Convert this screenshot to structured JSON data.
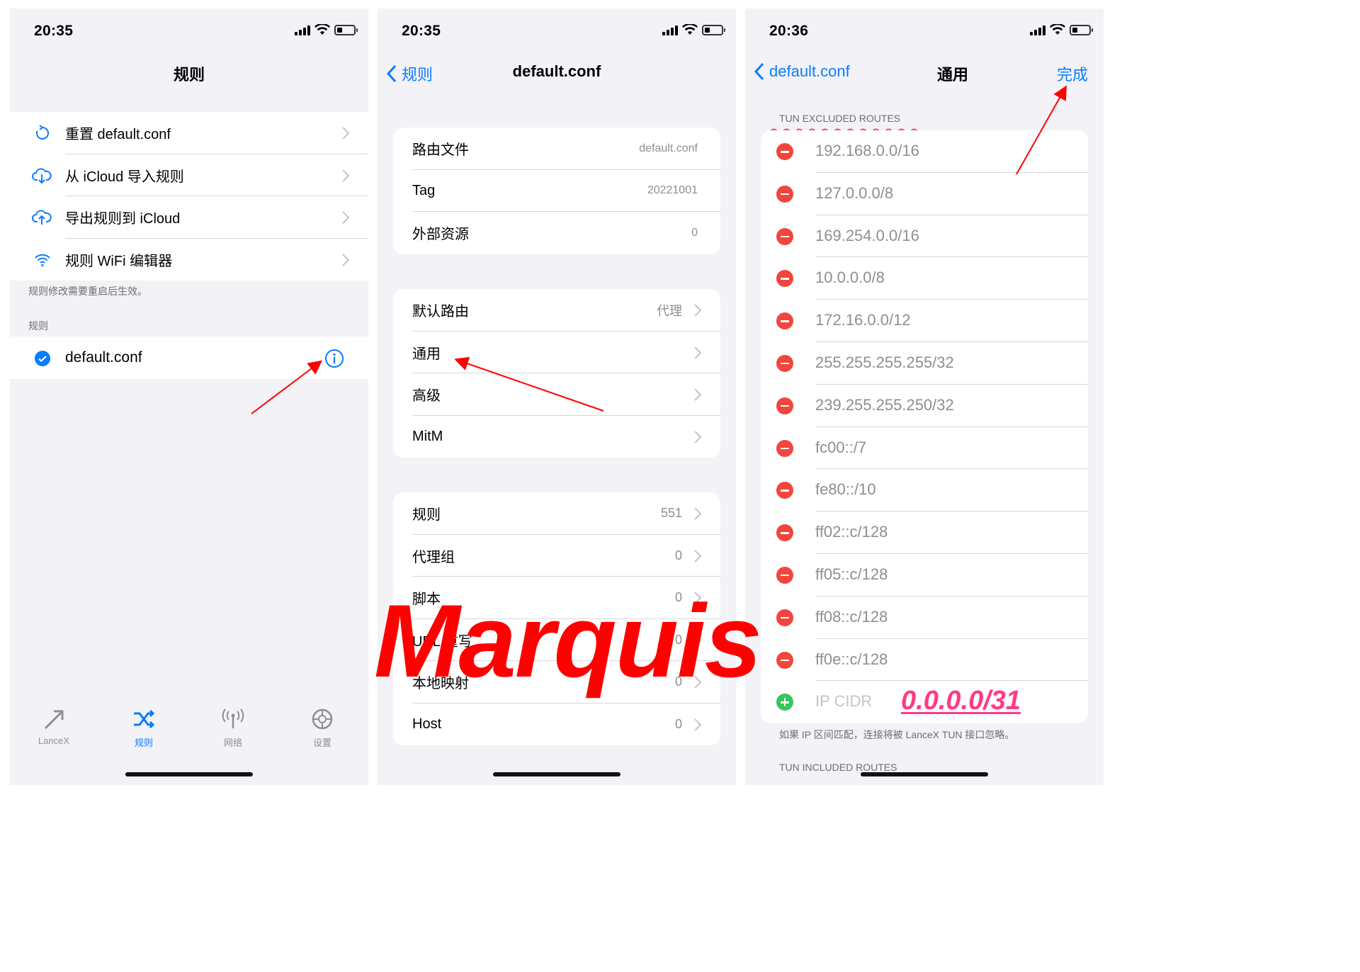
{
  "colors": {
    "accent": "#0a7cff",
    "annotation_red": "#ff0000",
    "annotation_pink": "#ff3a86",
    "remove_red": "#f2453d",
    "add_green": "#34c759"
  },
  "screen1": {
    "time": "20:35",
    "title": "规则",
    "actions": [
      {
        "icon": "refresh-icon",
        "label": "重置 default.conf"
      },
      {
        "icon": "cloud-download-icon",
        "label": "从 iCloud 导入规则"
      },
      {
        "icon": "cloud-upload-icon",
        "label": "导出规则到 iCloud"
      },
      {
        "icon": "wifi-icon",
        "label": "规则 WiFi 编辑器"
      }
    ],
    "footer_note": "规则修改需要重启后生效。",
    "section_header": "规则",
    "config_name": "default.conf",
    "tabs": [
      {
        "icon": "arrow-icon",
        "label": "LanceX"
      },
      {
        "icon": "shuffle-icon",
        "label": "规则"
      },
      {
        "icon": "antenna-icon",
        "label": "网络"
      },
      {
        "icon": "gear-icon",
        "label": "设置"
      }
    ]
  },
  "screen2": {
    "time": "20:35",
    "back_label": "规则",
    "title": "default.conf",
    "group1": [
      {
        "label": "路由文件",
        "value": "default.conf"
      },
      {
        "label": "Tag",
        "value": "20221001"
      },
      {
        "label": "外部资源",
        "value": "0"
      }
    ],
    "group2": [
      {
        "label": "默认路由",
        "value": "代理"
      },
      {
        "label": "通用",
        "value": ""
      },
      {
        "label": "高级",
        "value": ""
      },
      {
        "label": "MitM",
        "value": ""
      }
    ],
    "group3": [
      {
        "label": "规则",
        "value": "551"
      },
      {
        "label": "代理组",
        "value": "0"
      },
      {
        "label": "脚本",
        "value": "0"
      },
      {
        "label": "URL 重写",
        "value": "0"
      },
      {
        "label": "本地映射",
        "value": "0"
      },
      {
        "label": "Host",
        "value": "0"
      }
    ]
  },
  "screen3": {
    "time": "20:36",
    "back_label": "default.conf",
    "title": "通用",
    "done_label": "完成",
    "excluded_header": "TUN EXCLUDED ROUTES",
    "excluded_routes": [
      "192.168.0.0/16",
      "127.0.0.0/8",
      "169.254.0.0/16",
      "10.0.0.0/8",
      "172.16.0.0/12",
      "255.255.255.255/32",
      "239.255.255.250/32",
      "fc00::/7",
      "fe80::/10",
      "ff02::c/128",
      "ff05::c/128",
      "ff08::c/128",
      "ff0e::c/128"
    ],
    "add_placeholder": "IP CIDR",
    "footer_note": "如果 IP 区间匹配，连接将被 LanceX TUN 接口忽略。",
    "included_header": "TUN INCLUDED ROUTES"
  },
  "annotations": {
    "watermark": "Marquis",
    "cidr_example": "0.0.0.0/31"
  }
}
